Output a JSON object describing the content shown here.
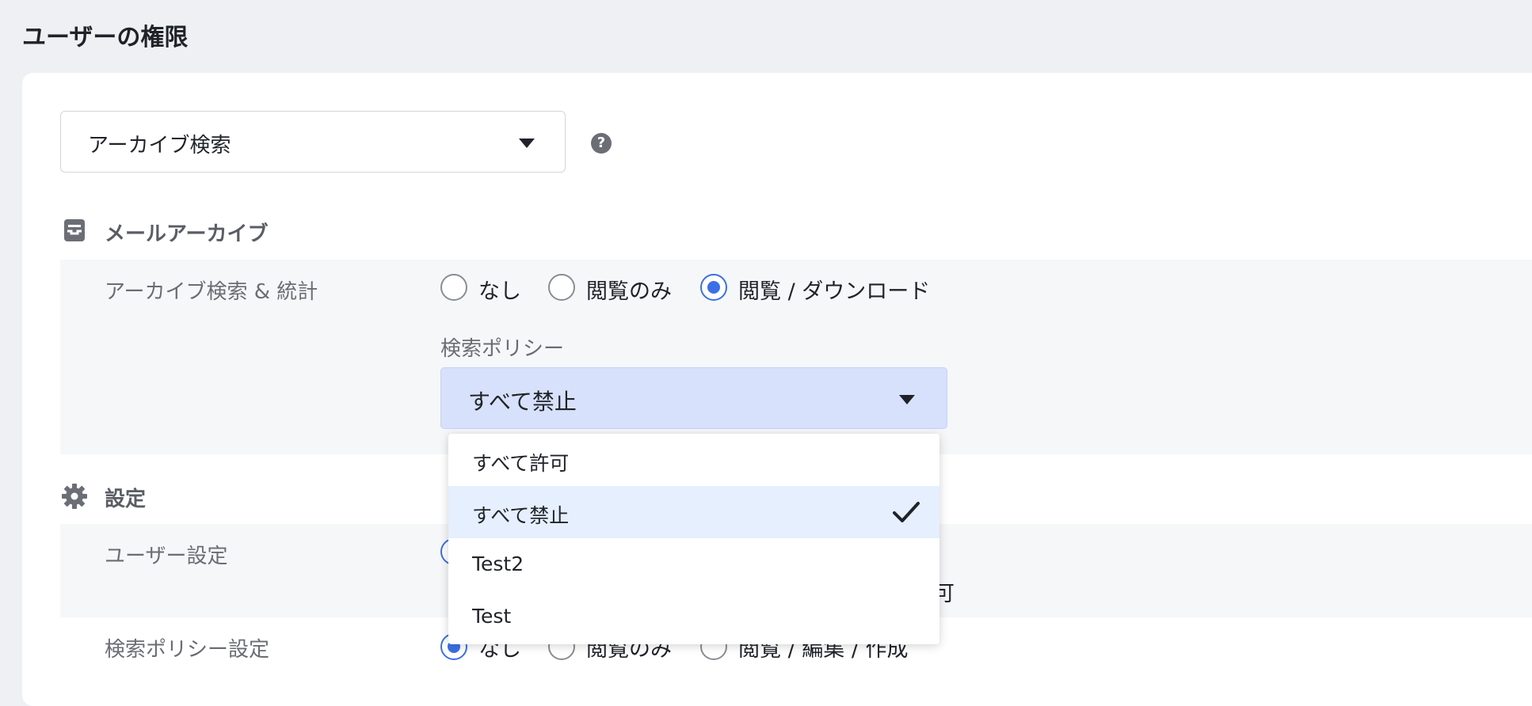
{
  "page_title": "ユーザーの権限",
  "role_select": {
    "value": "アーカイブ検索"
  },
  "help_icon_glyph": "?",
  "sections": {
    "mail_archive": {
      "header": "メールアーカイブ",
      "icon": "archive-box-icon",
      "rows": {
        "archive_search": {
          "label": "アーカイブ検索 & 統計",
          "options": [
            "なし",
            "閲覧のみ",
            "閲覧 / ダウンロード"
          ],
          "selected_index": 2
        }
      },
      "search_policy": {
        "label": "検索ポリシー",
        "value": "すべて禁止",
        "options": [
          "すべて許可",
          "すべて禁止",
          "Test2",
          "Test"
        ],
        "selected_index": 1
      }
    },
    "settings": {
      "header": "設定",
      "icon": "gear-icon",
      "rows": {
        "user_settings": {
          "label": "ユーザー設定",
          "partial_text": "可"
        },
        "search_policy_settings": {
          "label": "検索ポリシー設定",
          "options": [
            "なし",
            "閲覧のみ",
            "閲覧 / 編集 / 作成"
          ],
          "selected_index": 0
        }
      }
    }
  },
  "colors": {
    "accent": "#3c6fe6",
    "dropdown_selected_bg": "#e6effd",
    "select_bg": "#d8e1fb"
  }
}
